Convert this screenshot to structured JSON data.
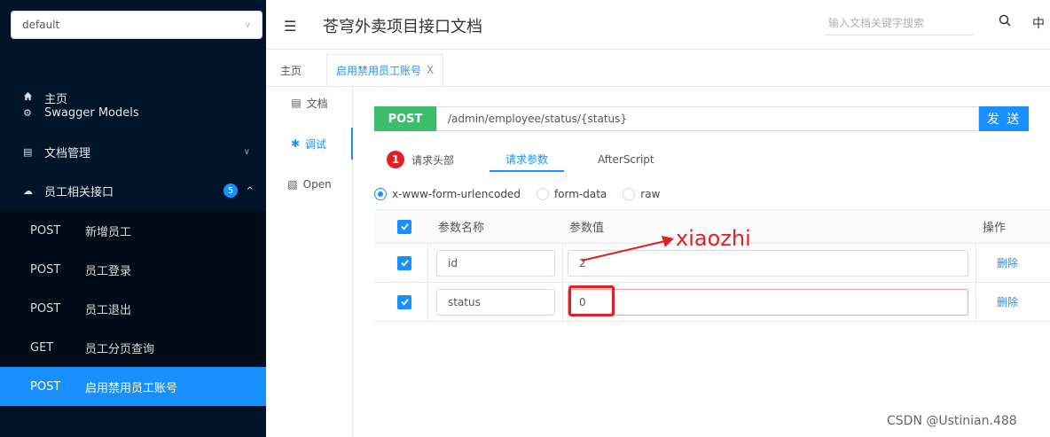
{
  "sidebar": {
    "group_select": "default",
    "menu": [
      {
        "icon": "home-icon",
        "label": "主页"
      },
      {
        "icon": "models-icon",
        "label": "Swagger Models"
      },
      {
        "icon": "doc-manage-icon",
        "label": "文档管理"
      },
      {
        "icon": "cloud-icon",
        "label": "员工相关接口",
        "badge": "5"
      }
    ],
    "sub_items": [
      {
        "method": "POST",
        "label": "新增员工"
      },
      {
        "method": "POST",
        "label": "员工登录"
      },
      {
        "method": "POST",
        "label": "员工退出"
      },
      {
        "method": "GET",
        "label": "员工分页查询"
      },
      {
        "method": "POST",
        "label": "启用禁用员工账号"
      }
    ]
  },
  "header": {
    "title": "苍穹外卖项目接口文档",
    "search_placeholder": "输入文档关键字搜索",
    "lang": "中"
  },
  "tabs": [
    {
      "label": "主页"
    },
    {
      "label": "启用禁用员工账号"
    }
  ],
  "subnav": [
    {
      "icon": "doc-icon",
      "label": "文档"
    },
    {
      "icon": "debug-icon",
      "label": "调试"
    },
    {
      "icon": "open-icon",
      "label": "Open"
    }
  ],
  "request": {
    "method": "POST",
    "url": "/admin/employee/status/{status}",
    "send_label": "发 送"
  },
  "param_tabs": [
    {
      "label": "请求头部",
      "count": "1"
    },
    {
      "label": "请求参数"
    },
    {
      "label": "AfterScript"
    }
  ],
  "content_types": [
    "x-www-form-urlencoded",
    "form-data",
    "raw"
  ],
  "table": {
    "headers": [
      "参数名称",
      "参数值",
      "操作"
    ],
    "rows": [
      {
        "name": "id",
        "value": "2",
        "action": "删除"
      },
      {
        "name": "status",
        "value": "0",
        "action": "删除"
      }
    ]
  },
  "annotation": "xiaozhi",
  "watermark": "CSDN @Ustinian.488"
}
